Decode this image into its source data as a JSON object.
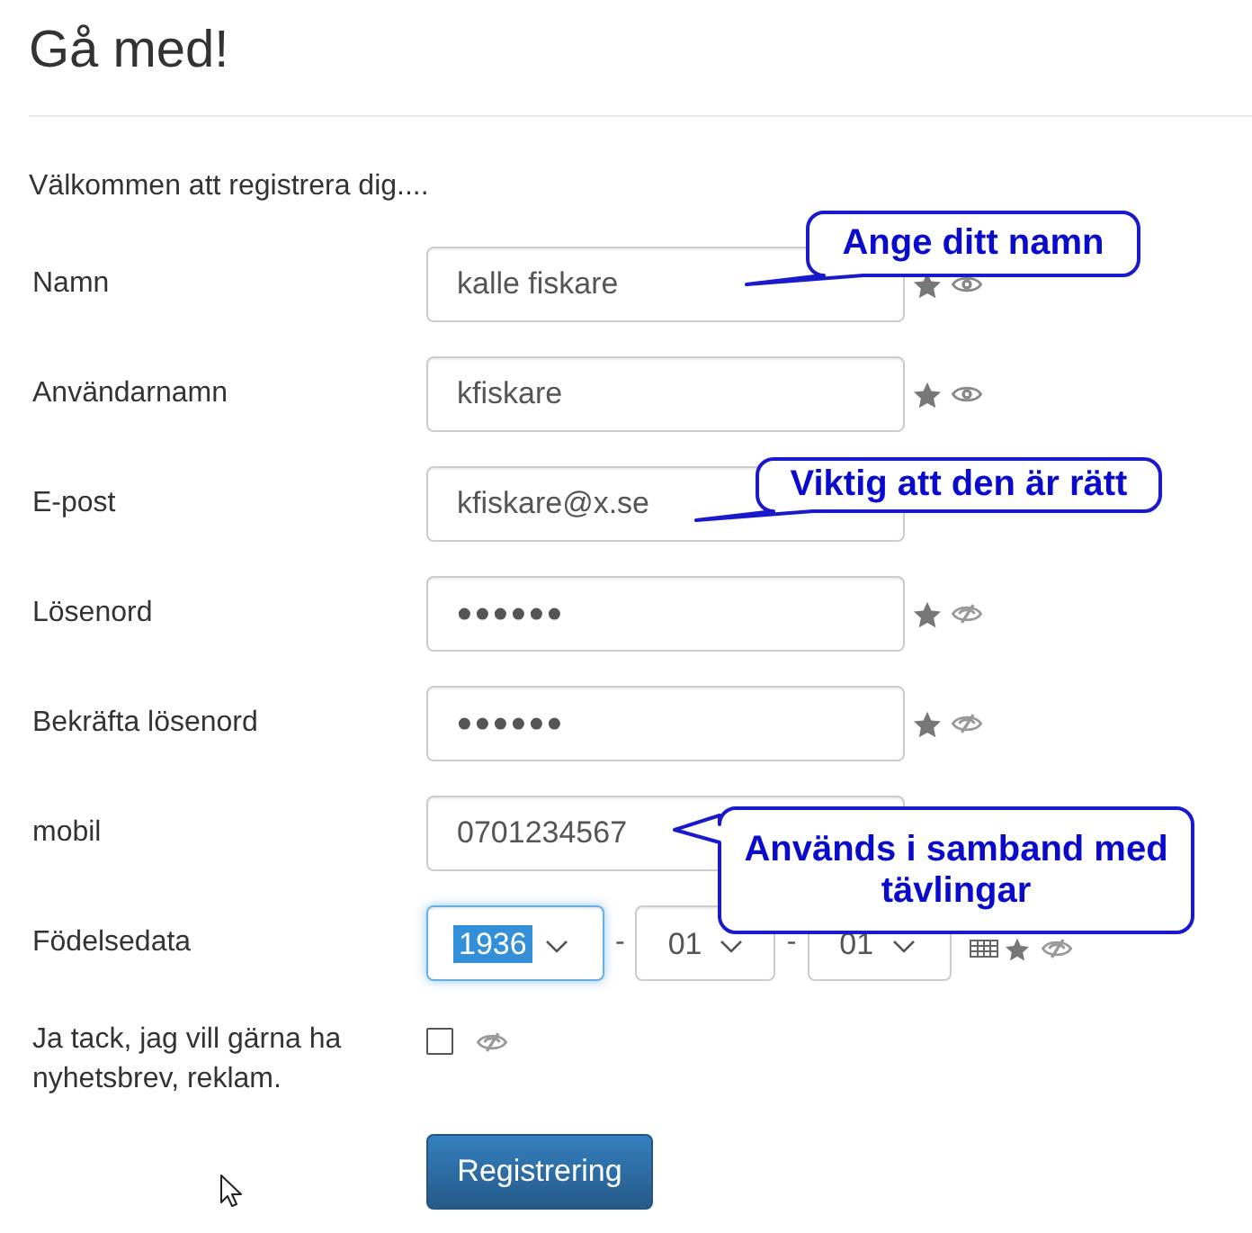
{
  "page": {
    "title": "Gå med!",
    "intro": "Välkommen att registrera dig...."
  },
  "fields": [
    {
      "kind": "text",
      "label": "Namn",
      "value": "kalle fiskare",
      "status": {
        "required": true,
        "shared": true
      },
      "callout": "Ange ditt namn"
    },
    {
      "kind": "text",
      "label": "Användarnamn",
      "value": "kfiskare",
      "status": {
        "required": true,
        "shared": true
      }
    },
    {
      "kind": "text",
      "label": "E-post",
      "value": "kfiskare@x.se",
      "callout": "Viktig att den är rätt"
    },
    {
      "kind": "password",
      "label": "Lösenord",
      "value": "••••••",
      "status": {
        "required": true,
        "shared": false
      }
    },
    {
      "kind": "password",
      "label": "Bekräfta lösenord",
      "value": "••••••",
      "status": {
        "required": true,
        "shared": false
      }
    },
    {
      "kind": "text",
      "label": "mobil",
      "value": "0701234567",
      "callout": "Används i samband med tävlingar"
    },
    {
      "kind": "date",
      "label": "Födelsedata",
      "parts": [
        {
          "value": "1936",
          "focused": true
        },
        {
          "value": "01",
          "focused": false
        },
        {
          "value": "01",
          "focused": false
        }
      ],
      "separators": [
        "-",
        "-"
      ],
      "status": {
        "required": true,
        "shared": false
      }
    },
    {
      "kind": "checkbox",
      "label": "Ja tack, jag vill gärna ha nyhetsbrev, reklam.",
      "checked": false,
      "status": {
        "shared": false
      }
    }
  ],
  "submit": {
    "label": "Registrering"
  }
}
